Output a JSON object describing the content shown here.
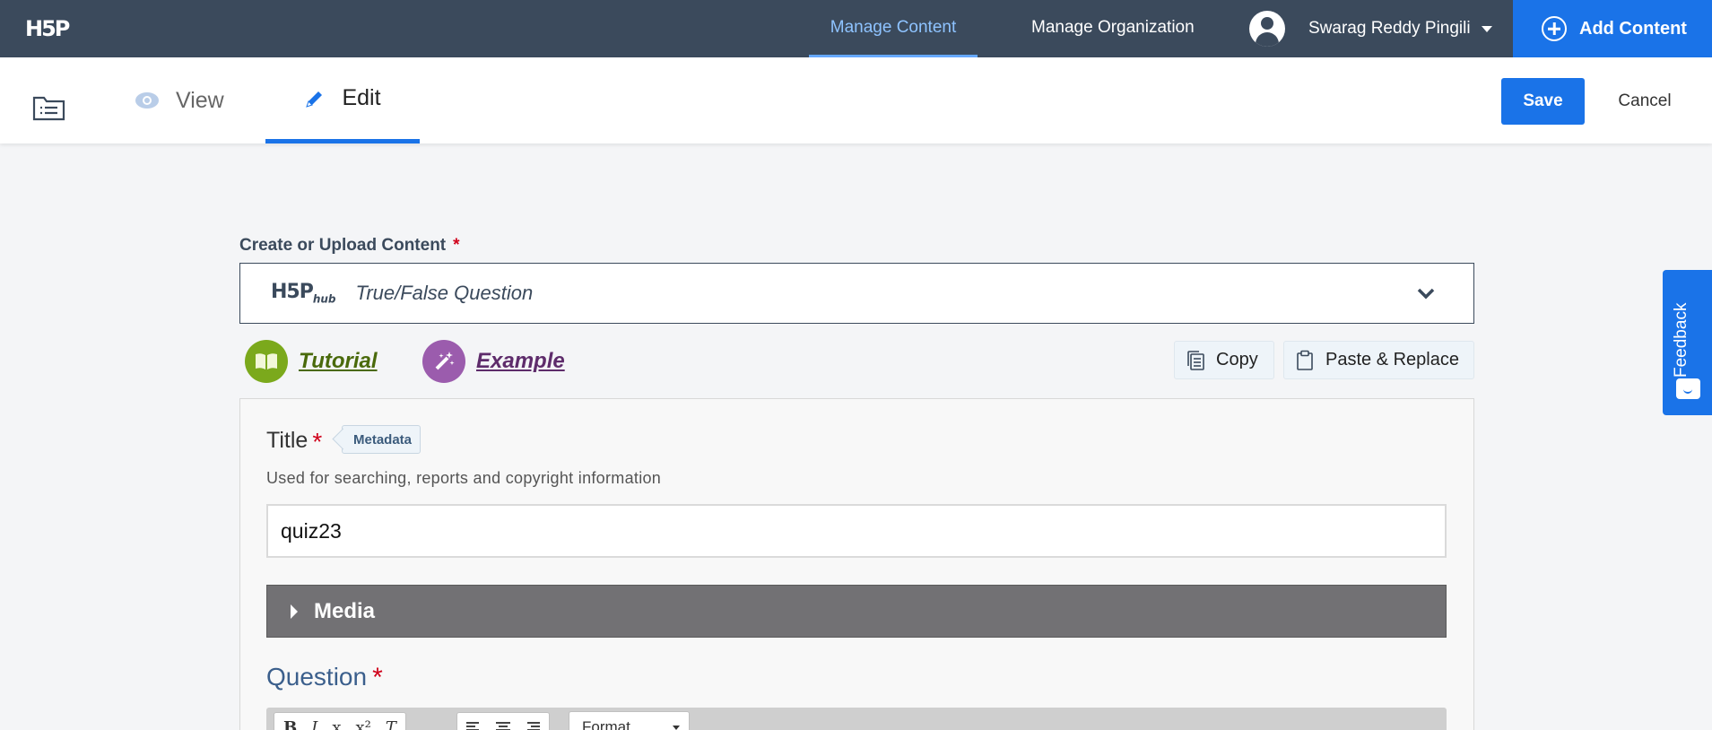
{
  "brand": {
    "logo": "H5P"
  },
  "nav": {
    "links": [
      {
        "label": "Manage Content",
        "active": true
      },
      {
        "label": "Manage Organization",
        "active": false
      }
    ],
    "user_name": "Swarag Reddy Pingili",
    "add_content": "Add Content"
  },
  "toolbar": {
    "tabs": [
      {
        "label": "View",
        "active": false
      },
      {
        "label": "Edit",
        "active": true
      }
    ],
    "save_label": "Save",
    "cancel_label": "Cancel"
  },
  "content": {
    "section_label": "Create or Upload Content",
    "required_mark": "*",
    "hub_logo": "H5P",
    "hub_logo_sub": "hub",
    "content_type": "True/False Question",
    "tutorial_label": "Tutorial",
    "example_label": "Example",
    "copy_label": "Copy",
    "paste_label": "Paste & Replace"
  },
  "form": {
    "title_label": "Title",
    "metadata_label": "Metadata",
    "title_desc": "Used for searching, reports and copyright information",
    "title_value": "quiz23",
    "media_label": "Media",
    "question_label": "Question",
    "editor_buttons": [
      "B",
      "I",
      "x",
      "x²",
      "T"
    ],
    "format_label": "Format"
  },
  "feedback": {
    "label": "Feedback"
  },
  "colors": {
    "nav_bg": "#3b4a5c",
    "accent": "#1a73e8",
    "active_link": "#8ec3ff",
    "required": "#d0021b",
    "tutorial_green": "#7ba91c",
    "example_purple": "#9b5cad",
    "media_bar": "#727174"
  }
}
